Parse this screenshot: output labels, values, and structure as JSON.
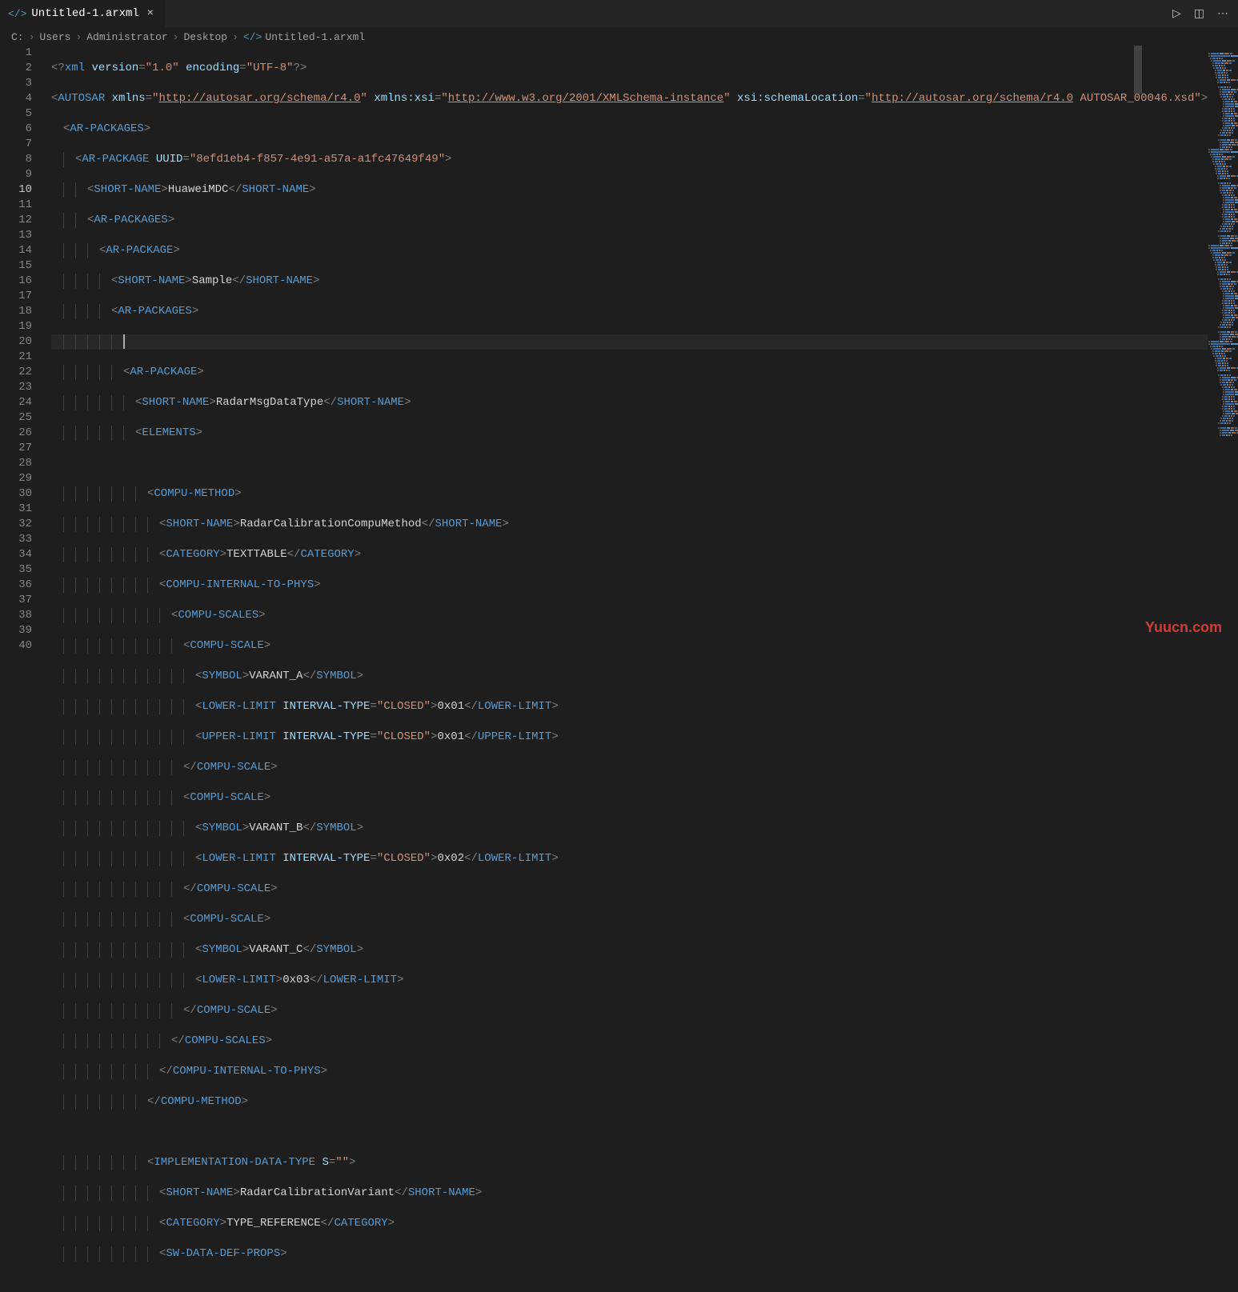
{
  "tab": {
    "title": "Untitled-1.arxml"
  },
  "breadcrumb": {
    "parts": [
      "C:",
      "Users",
      "Administrator",
      "Desktop"
    ],
    "file": "Untitled-1.arxml"
  },
  "watermark": "Yuucn.com",
  "line_numbers": [
    "1",
    "2",
    "3",
    "4",
    "5",
    "6",
    "7",
    "8",
    "9",
    "10",
    "11",
    "12",
    "13",
    "14",
    "15",
    "16",
    "17",
    "18",
    "19",
    "20",
    "21",
    "22",
    "23",
    "24",
    "25",
    "26",
    "27",
    "28",
    "29",
    "30",
    "31",
    "32",
    "33",
    "34",
    "35",
    "36",
    "37",
    "38",
    "39",
    "40"
  ],
  "code": {
    "l1": {
      "prolog_open": "<?",
      "prolog_name": "xml",
      "attr1": "version",
      "val1": "\"1.0\"",
      "attr2": "encoding",
      "val2": "\"UTF-8\"",
      "prolog_close": "?>"
    },
    "l2": {
      "tag": "AUTOSAR",
      "attr1": "xmlns",
      "val1_pre": "\"",
      "val1_link": "http://autosar.org/schema/r4.0",
      "val1_post": "\"",
      "attr2": "xmlns:xsi",
      "val2_pre": "\"",
      "val2_link": "http://www.w3.org/2001/XMLSchema-instance",
      "val2_post": "\"",
      "attr3": "xsi:schemaLocation",
      "val3_pre": "\"",
      "val3_link": "http://autosar.org/schema/r4.0",
      "val3_rest": " AUTOSAR_00046.xsd\""
    },
    "l3": {
      "tag": "AR-PACKAGES"
    },
    "l4": {
      "tag": "AR-PACKAGE",
      "attr": "UUID",
      "val": "\"8efd1eb4-f857-4e91-a57a-a1fc47649f49\""
    },
    "l5": {
      "open": "SHORT-NAME",
      "text": "HuaweiMDC",
      "close": "SHORT-NAME"
    },
    "l6": {
      "tag": "AR-PACKAGES"
    },
    "l7": {
      "tag": "AR-PACKAGE"
    },
    "l8": {
      "open": "SHORT-NAME",
      "text": "Sample",
      "close": "SHORT-NAME"
    },
    "l9": {
      "tag": "AR-PACKAGES"
    },
    "l11": {
      "tag": "AR-PACKAGE"
    },
    "l12": {
      "open": "SHORT-NAME",
      "text": "RadarMsgDataType",
      "close": "SHORT-NAME"
    },
    "l13": {
      "tag": "ELEMENTS"
    },
    "l15": {
      "tag": "COMPU-METHOD"
    },
    "l16": {
      "open": "SHORT-NAME",
      "text": "RadarCalibrationCompuMethod",
      "close": "SHORT-NAME"
    },
    "l17": {
      "open": "CATEGORY",
      "text": "TEXTTABLE",
      "close": "CATEGORY"
    },
    "l18": {
      "tag": "COMPU-INTERNAL-TO-PHYS"
    },
    "l19": {
      "tag": "COMPU-SCALES"
    },
    "l20": {
      "tag": "COMPU-SCALE"
    },
    "l21": {
      "open": "SYMBOL",
      "text": "VARANT_A",
      "close": "SYMBOL"
    },
    "l22": {
      "open": "LOWER-LIMIT",
      "attr": "INTERVAL-TYPE",
      "val": "\"CLOSED\"",
      "text": "0x01",
      "close": "LOWER-LIMIT"
    },
    "l23": {
      "open": "UPPER-LIMIT",
      "attr": "INTERVAL-TYPE",
      "val": "\"CLOSED\"",
      "text": "0x01",
      "close": "UPPER-LIMIT"
    },
    "l24": {
      "close": "COMPU-SCALE"
    },
    "l25": {
      "tag": "COMPU-SCALE"
    },
    "l26": {
      "open": "SYMBOL",
      "text": "VARANT_B",
      "close": "SYMBOL"
    },
    "l27": {
      "open": "LOWER-LIMIT",
      "attr": "INTERVAL-TYPE",
      "val": "\"CLOSED\"",
      "text": "0x02",
      "close": "LOWER-LIMIT"
    },
    "l28": {
      "close": "COMPU-SCALE"
    },
    "l29": {
      "tag": "COMPU-SCALE"
    },
    "l30": {
      "open": "SYMBOL",
      "text": "VARANT_C",
      "close": "SYMBOL"
    },
    "l31": {
      "open": "LOWER-LIMIT",
      "text": "0x03",
      "close": "LOWER-LIMIT"
    },
    "l32": {
      "close": "COMPU-SCALE"
    },
    "l33": {
      "close": "COMPU-SCALES"
    },
    "l34": {
      "close": "COMPU-INTERNAL-TO-PHYS"
    },
    "l35": {
      "close": "COMPU-METHOD"
    },
    "l37": {
      "tag": "IMPLEMENTATION-DATA-TYPE",
      "attr": "S",
      "val": "\"\""
    },
    "l38": {
      "open": "SHORT-NAME",
      "text": "RadarCalibrationVariant",
      "close": "SHORT-NAME"
    },
    "l39": {
      "open": "CATEGORY",
      "text": "TYPE_REFERENCE",
      "close": "CATEGORY"
    },
    "l40": {
      "tag": "SW-DATA-DEF-PROPS"
    }
  }
}
